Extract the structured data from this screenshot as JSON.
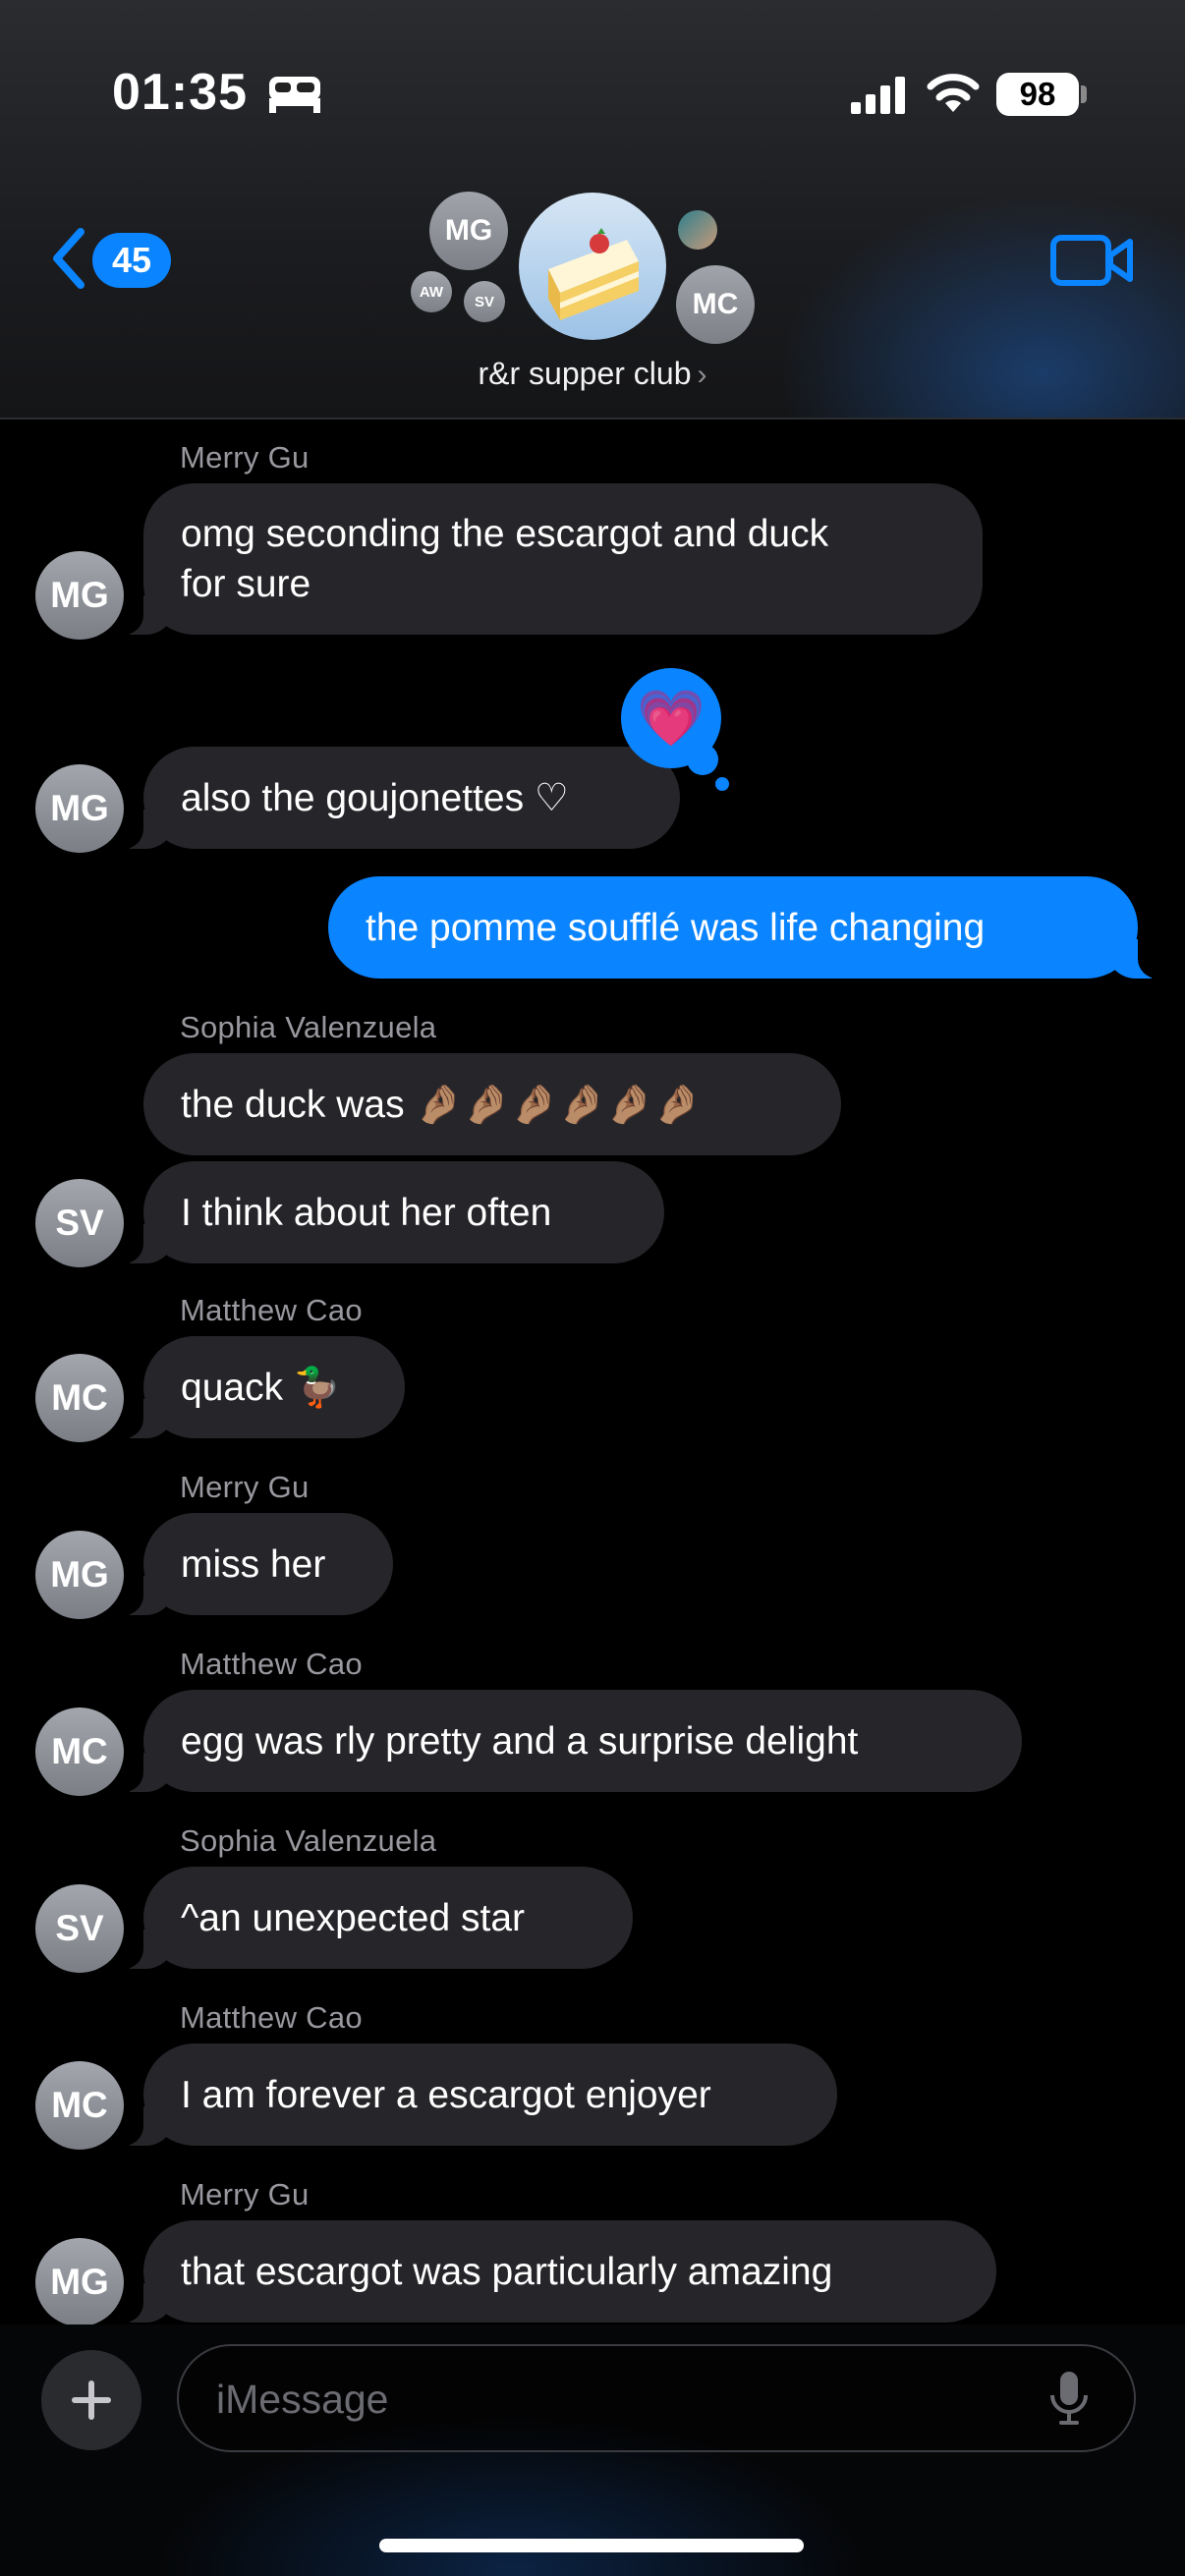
{
  "status_bar": {
    "time": "01:35",
    "battery": "98"
  },
  "header": {
    "back_count": "45",
    "group_name": "r&r supper club",
    "avatars": {
      "mg": "MG",
      "aw": "AW",
      "sv": "SV",
      "mc": "MC"
    }
  },
  "messages": [
    {
      "sender": "Merry Gu",
      "text_lines": [
        "omg seconding the escargot and duck",
        "for sure"
      ],
      "avatar": "MG"
    },
    {
      "text": "also the goujonettes ♡",
      "avatar": "MG",
      "reaction": "heart"
    },
    {
      "text": "the pomme soufflé was life changing",
      "outgoing": true
    },
    {
      "sender": "Sophia Valenzuela",
      "text": "the duck was 🤌🏽🤌🏽🤌🏽🤌🏽🤌🏽🤌🏽"
    },
    {
      "text": "I think about her often",
      "avatar": "SV"
    },
    {
      "sender": "Matthew Cao",
      "text": "quack 🦆",
      "avatar": "MC"
    },
    {
      "sender": "Merry Gu",
      "text": "miss her",
      "avatar": "MG"
    },
    {
      "sender": "Matthew Cao",
      "text": "egg was rly pretty and a surprise delight",
      "avatar": "MC"
    },
    {
      "sender": "Sophia Valenzuela",
      "text": "^an unexpected star",
      "avatar": "SV"
    },
    {
      "sender": "Matthew Cao",
      "text": "I am forever a escargot enjoyer",
      "avatar": "MC"
    },
    {
      "sender": "Merry Gu",
      "text": "that escargot was particularly amazing",
      "avatar": "MG"
    }
  ],
  "composer": {
    "placeholder": "iMessage"
  },
  "colors": {
    "accent": "#0a84ff",
    "incoming_bubble": "#26262a",
    "background": "#000000"
  }
}
